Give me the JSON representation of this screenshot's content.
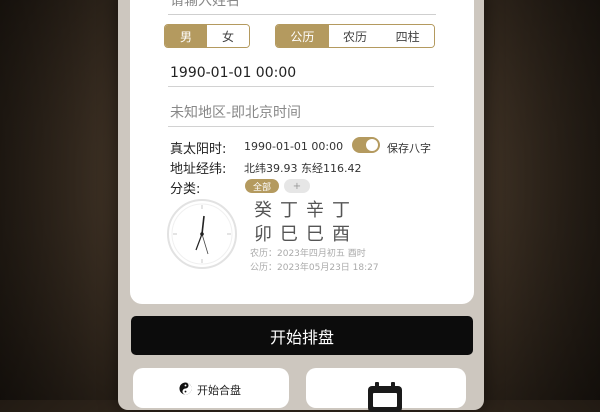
{
  "form": {
    "name_placeholder": "请输入姓名",
    "gender_options": [
      "男",
      "女"
    ],
    "calendar_options": [
      "公历",
      "农历",
      "四柱"
    ],
    "birth_datetime": "1990-01-01 00:00",
    "location_placeholder": "未知地区-即北京时间"
  },
  "info": {
    "true_solar_label": "真太阳时:",
    "true_solar_value": "1990-01-01 00:00",
    "save_bazi_label": "保存八字",
    "coords_label": "地址经纬:",
    "coords_value": "北纬39.93 东经116.42",
    "category_label": "分类:",
    "category_tag": "全部",
    "category_add": "+"
  },
  "pillars": {
    "stems": [
      "癸",
      "丁",
      "辛",
      "丁"
    ],
    "branches": [
      "卯",
      "巳",
      "巳",
      "酉"
    ],
    "lunar_date": "农历：2023年四月初五 酉时",
    "solar_date": "公历：2023年05月23日 18:27"
  },
  "actions": {
    "start_chart": "开始排盘",
    "start_merge": "开始合盘"
  },
  "colors": {
    "accent": "#b49a5f",
    "button_dark": "#0c0c0c"
  }
}
